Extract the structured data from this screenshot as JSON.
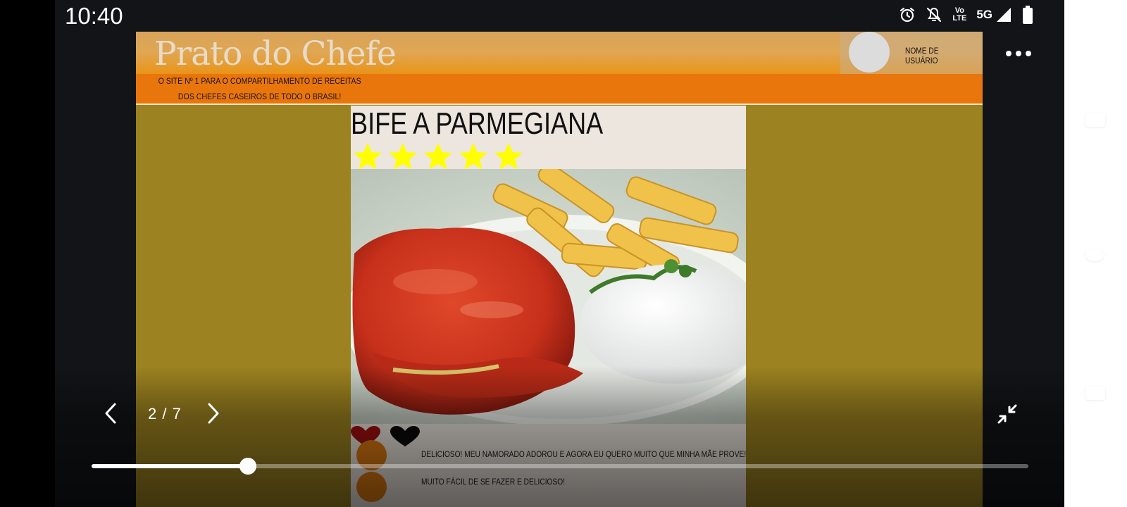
{
  "status_bar": {
    "time": "10:40",
    "volte_line1": "Vo",
    "volte_line2": "LTE",
    "network": "5G",
    "icons": [
      "alarm-icon",
      "notifications-off-icon",
      "volte-icon",
      "signal-icon",
      "battery-icon"
    ]
  },
  "site": {
    "logo": "Prato do Chefe",
    "tagline": "O SITE  Nº 1 PARA O COMPARTILHAMENTO DE RECEITAS DOS CHEFES CASEIROS DE TODO O BRASIL!",
    "username": "NOME DE USUÁRIO",
    "colors": {
      "header": "#e8760c",
      "background": "#9c8220",
      "card": "#ede6de"
    }
  },
  "recipe": {
    "title": "BIFE A PARMEGIANA",
    "rating": 5,
    "rating_max": 5,
    "star_color": "#ffff00",
    "hearts": [
      "heart-red-icon",
      "heart-black-icon"
    ],
    "comments": [
      {
        "text": "DELICIOSO! MEU NAMORADO ADOROU E AGORA EU QUERO MUITO QUE MINHA MÃE PROVE!"
      },
      {
        "text": "MUITO FÁCIL DE SE FAZER E DELICIOSO!"
      }
    ]
  },
  "viewer": {
    "counter": "2 / 7",
    "current": 2,
    "total": 7,
    "progress": 0.167,
    "icons": [
      "more-options-icon",
      "previous-icon",
      "next-icon",
      "collapse-icon"
    ]
  }
}
